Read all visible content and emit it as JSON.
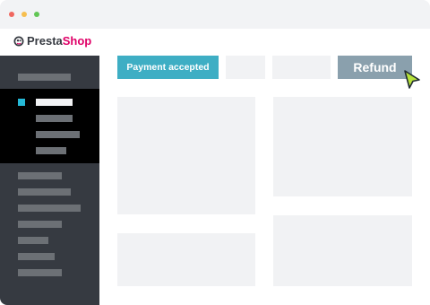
{
  "window": {
    "controls": [
      "close",
      "minimize",
      "maximize"
    ]
  },
  "header": {
    "logo_part1": "Presta",
    "logo_part2": "Shop",
    "logo_icon": "prestashop-logo-icon"
  },
  "main": {
    "status_label": "Payment accepted",
    "refund_label": "Refund"
  },
  "colors": {
    "status_badge": "#3eaec4",
    "refund_button": "#8aa0ad",
    "brand_pink": "#df0067",
    "sidebar": "#363a41",
    "sidebar_active": "#000000",
    "active_indicator": "#25b9d7",
    "cursor": "#b7e23b"
  },
  "cursor": {
    "icon": "mouse-pointer-icon"
  }
}
